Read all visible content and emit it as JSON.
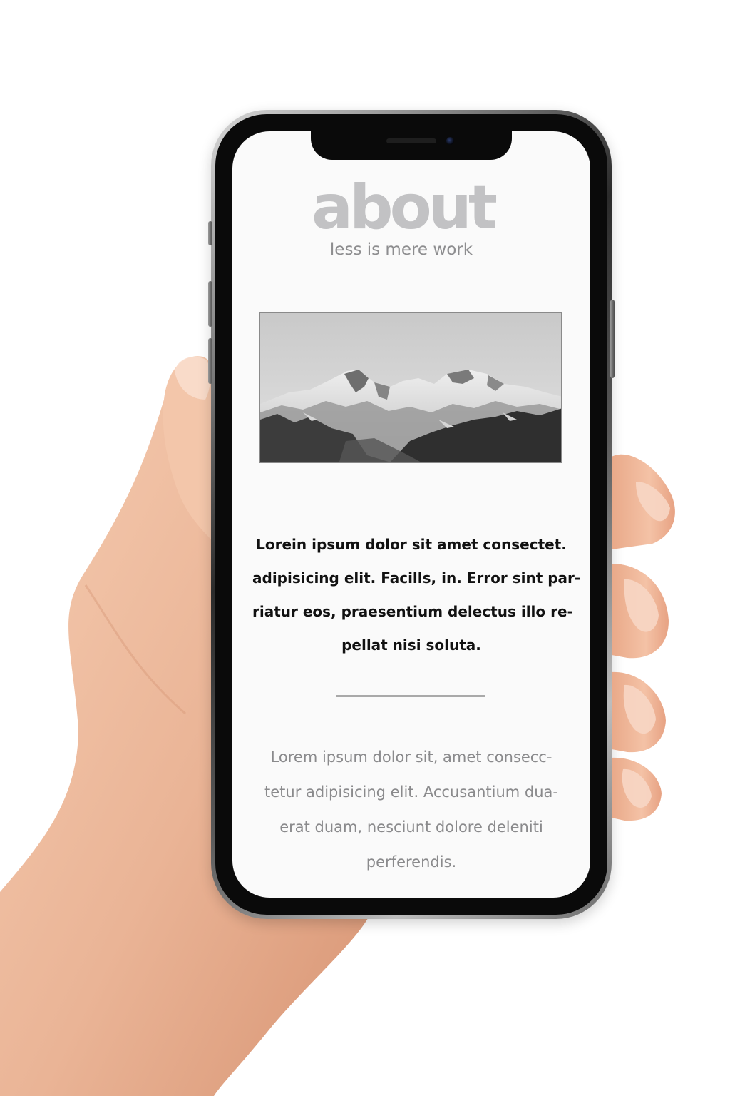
{
  "page": {
    "title": "about",
    "subtitle": "less is mere work"
  },
  "hero_image": {
    "alt": "mountain-range"
  },
  "lead": {
    "lines": [
      "Lorein ipsum dolor sit amet consectet.",
      "adipisicing elit. Facills, in. Error sint par-",
      "riatur eos, praesentium delectus illo re-",
      "pellat nisi soluta."
    ]
  },
  "body": {
    "lines": [
      "Lorem ipsum dolor sit, amet consecc-",
      "tetur adipisicing elit. Accusantium dua-",
      "erat duam, nesciunt dolore deleniti",
      "perferendis."
    ]
  },
  "colors": {
    "title": "#c2c2c4",
    "subtitle": "#8d8d8f",
    "lead_text": "#111111",
    "body_text": "#8a8a8c",
    "divider": "#a9a9a9",
    "screen_bg": "#fafafa"
  },
  "icons": {
    "camera": "front-camera-icon",
    "speaker": "earpiece-speaker-icon"
  }
}
